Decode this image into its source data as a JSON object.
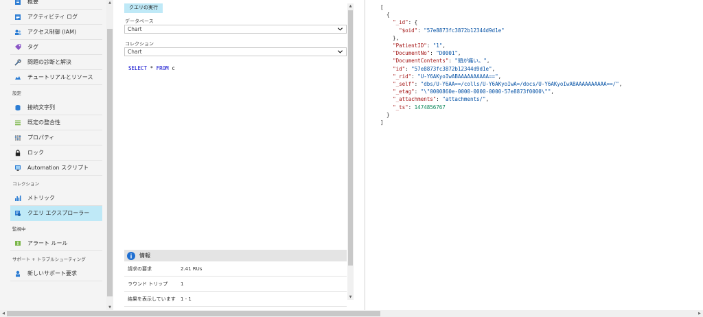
{
  "sidebar": {
    "items": [
      {
        "label": "概要",
        "icon": "overview-icon"
      },
      {
        "label": "アクティビティ ログ",
        "icon": "activity-log-icon"
      },
      {
        "label": "アクセス制御 (IAM)",
        "icon": "access-control-icon"
      },
      {
        "label": "タグ",
        "icon": "tag-icon"
      },
      {
        "label": "問題の診断と解決",
        "icon": "wrench-icon"
      },
      {
        "label": "チュートリアルとリソース",
        "icon": "cloud-icon"
      }
    ],
    "section_settings": "設定",
    "settings_items": [
      {
        "label": "接続文字列",
        "icon": "database-icon"
      },
      {
        "label": "既定の整合性",
        "icon": "list-icon"
      },
      {
        "label": "プロパティ",
        "icon": "sliders-icon"
      },
      {
        "label": "ロック",
        "icon": "lock-icon"
      },
      {
        "label": "Automation スクリプト",
        "icon": "monitor-icon"
      }
    ],
    "section_collection": "コレクション",
    "collection_items": [
      {
        "label": "メトリック",
        "icon": "bar-chart-icon"
      },
      {
        "label": "クエリ エクスプローラー",
        "icon": "query-explorer-icon",
        "active": true
      }
    ],
    "section_monitoring": "監視中",
    "monitoring_items": [
      {
        "label": "アラート ルール",
        "icon": "alert-icon"
      }
    ],
    "section_support": "サポート + トラブルシューティング",
    "support_items": [
      {
        "label": "新しいサポート要求",
        "icon": "support-person-icon"
      }
    ]
  },
  "query": {
    "run_button": "クエリの実行",
    "database_label": "データベース",
    "database_value": "Chart",
    "collection_label": "コレクション",
    "collection_value": "Chart",
    "text_select": "SELECT",
    "text_star": " * ",
    "text_from": "FROM",
    "text_rest": " c"
  },
  "info": {
    "title": "情報",
    "rows": [
      {
        "key": "請求の要求",
        "value": "2.41 RUs"
      },
      {
        "key": "ラウンド トリップ",
        "value": "1"
      },
      {
        "key": "結果を表示しています",
        "value": "1 - 1"
      }
    ]
  },
  "result": {
    "open_bracket": "[",
    "open_brace": "{",
    "id_key": "\"_id\"",
    "oid_key": "\"$oid\"",
    "oid_value": "\"57e8873fc3872b12344d9d1e\"",
    "patient_key": "\"PatientID\"",
    "patient_value": "\"1\"",
    "docno_key": "\"DocumentNo\"",
    "docno_value": "\"D0001\"",
    "contents_key": "\"DocumentContents\"",
    "contents_value": "\"頭が痛い。\"",
    "idfield_key": "\"id\"",
    "idfield_value": "\"57e8873fc3872b12344d9d1e\"",
    "rid_key": "\"_rid\"",
    "rid_value": "\"U-Y6AKyoIwABAAAAAAAAAA==\"",
    "self_key": "\"_self\"",
    "self_value": "\"dbs/U-Y6AA==/colls/U-Y6AKyoIwA=/docs/U-Y6AKyoIwABAAAAAAAAAA==/\"",
    "etag_key": "\"_etag\"",
    "etag_value": "\"\\\"0000860e-0000-0000-0000-57e8873f0000\\\"\"",
    "attach_key": "\"_attachments\"",
    "attach_value": "\"attachments/\"",
    "ts_key": "\"_ts\"",
    "ts_value": "1474856767",
    "close_brace": "}",
    "close_bracket": "]"
  },
  "colors": {
    "active_nav": "#bfe9f7",
    "json_key": "#a31515",
    "json_string": "#0451a5",
    "json_number": "#098658",
    "sql_keyword": "#0000cc",
    "info_icon": "#1f6fd1"
  }
}
